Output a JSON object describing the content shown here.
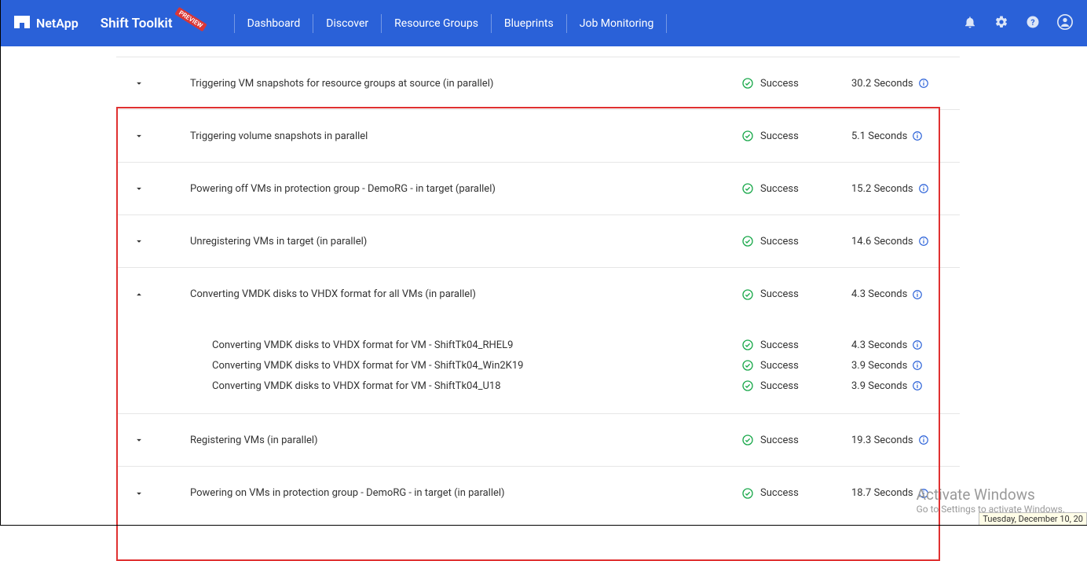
{
  "header": {
    "brand": "NetApp",
    "product": "Shift Toolkit",
    "badge": "PREVIEW",
    "nav": [
      "Dashboard",
      "Discover",
      "Resource Groups",
      "Blueprints",
      "Job Monitoring"
    ]
  },
  "jobs": [
    {
      "expanded": false,
      "label": "Triggering VM snapshots for resource groups at source (in parallel)",
      "status": "Success",
      "duration": "30.2 Seconds"
    },
    {
      "expanded": false,
      "label": "Triggering volume snapshots in parallel",
      "status": "Success",
      "duration": "5.1 Seconds"
    },
    {
      "expanded": false,
      "label": "Powering off VMs in protection group - DemoRG - in target (parallel)",
      "status": "Success",
      "duration": "15.2 Seconds"
    },
    {
      "expanded": false,
      "label": "Unregistering VMs in target (in parallel)",
      "status": "Success",
      "duration": "14.6 Seconds"
    },
    {
      "expanded": true,
      "label": "Converting VMDK disks to VHDX format for all VMs (in parallel)",
      "status": "Success",
      "duration": "4.3 Seconds",
      "children": [
        {
          "label": "Converting VMDK disks to VHDX format for VM - ShiftTk04_RHEL9",
          "status": "Success",
          "duration": "4.3 Seconds"
        },
        {
          "label": "Converting VMDK disks to VHDX format for VM - ShiftTk04_Win2K19",
          "status": "Success",
          "duration": "3.9 Seconds"
        },
        {
          "label": "Converting VMDK disks to VHDX format for VM - ShiftTk04_U18",
          "status": "Success",
          "duration": "3.9 Seconds"
        }
      ]
    },
    {
      "expanded": false,
      "label": "Registering VMs (in parallel)",
      "status": "Success",
      "duration": "19.3 Seconds"
    },
    {
      "expanded": false,
      "label": "Powering on VMs in protection group - DemoRG - in target (in parallel)",
      "status": "Success",
      "duration": "18.7 Seconds"
    }
  ],
  "watermark": {
    "line1": "Activate Windows",
    "line2": "Go to Settings to activate Windows."
  },
  "clock_tip": "Tuesday, December 10, 20",
  "colors": {
    "accent": "#2a61d8",
    "success": "#19a84a",
    "highlight_border": "#e03131"
  }
}
